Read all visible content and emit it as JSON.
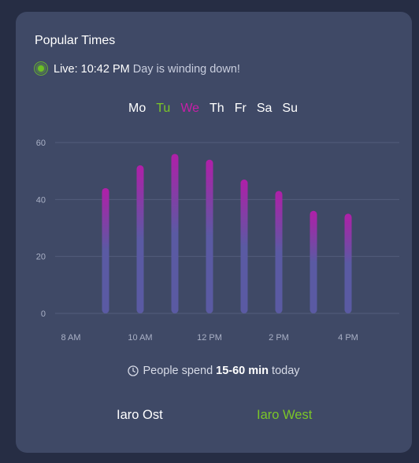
{
  "card": {
    "title": "Popular Times",
    "live": {
      "label": "Live:",
      "time": "10:42 PM",
      "message": "Day is winding down!"
    }
  },
  "days": [
    {
      "label": "Mo",
      "state": "default"
    },
    {
      "label": "Tu",
      "state": "today"
    },
    {
      "label": "We",
      "state": "selected"
    },
    {
      "label": "Th",
      "state": "default"
    },
    {
      "label": "Fr",
      "state": "default"
    },
    {
      "label": "Sa",
      "state": "default"
    },
    {
      "label": "Su",
      "state": "default"
    }
  ],
  "colors": {
    "today": "#7bc628",
    "selected": "#c61fa8",
    "bar_top": "#b01fa8",
    "bar_bottom": "#5a5aa3",
    "grid": "#535d7c"
  },
  "chart_data": {
    "type": "bar",
    "categories": [
      "8 AM",
      "9 AM",
      "10 AM",
      "11 AM",
      "12 PM",
      "1 PM",
      "2 PM",
      "3 PM",
      "4 PM"
    ],
    "values": [
      0,
      44,
      52,
      56,
      54,
      47,
      43,
      36,
      35
    ],
    "xticks": [
      "8 AM",
      "10 AM",
      "12 PM",
      "2 PM",
      "4 PM"
    ],
    "yticks": [
      0,
      20,
      40,
      60
    ],
    "ylim": [
      0,
      60
    ],
    "grid": true
  },
  "footer": {
    "prefix": "People spend",
    "duration": "15-60 min",
    "suffix": "today"
  },
  "locations": [
    "Iaro Ost",
    "Iaro West"
  ]
}
